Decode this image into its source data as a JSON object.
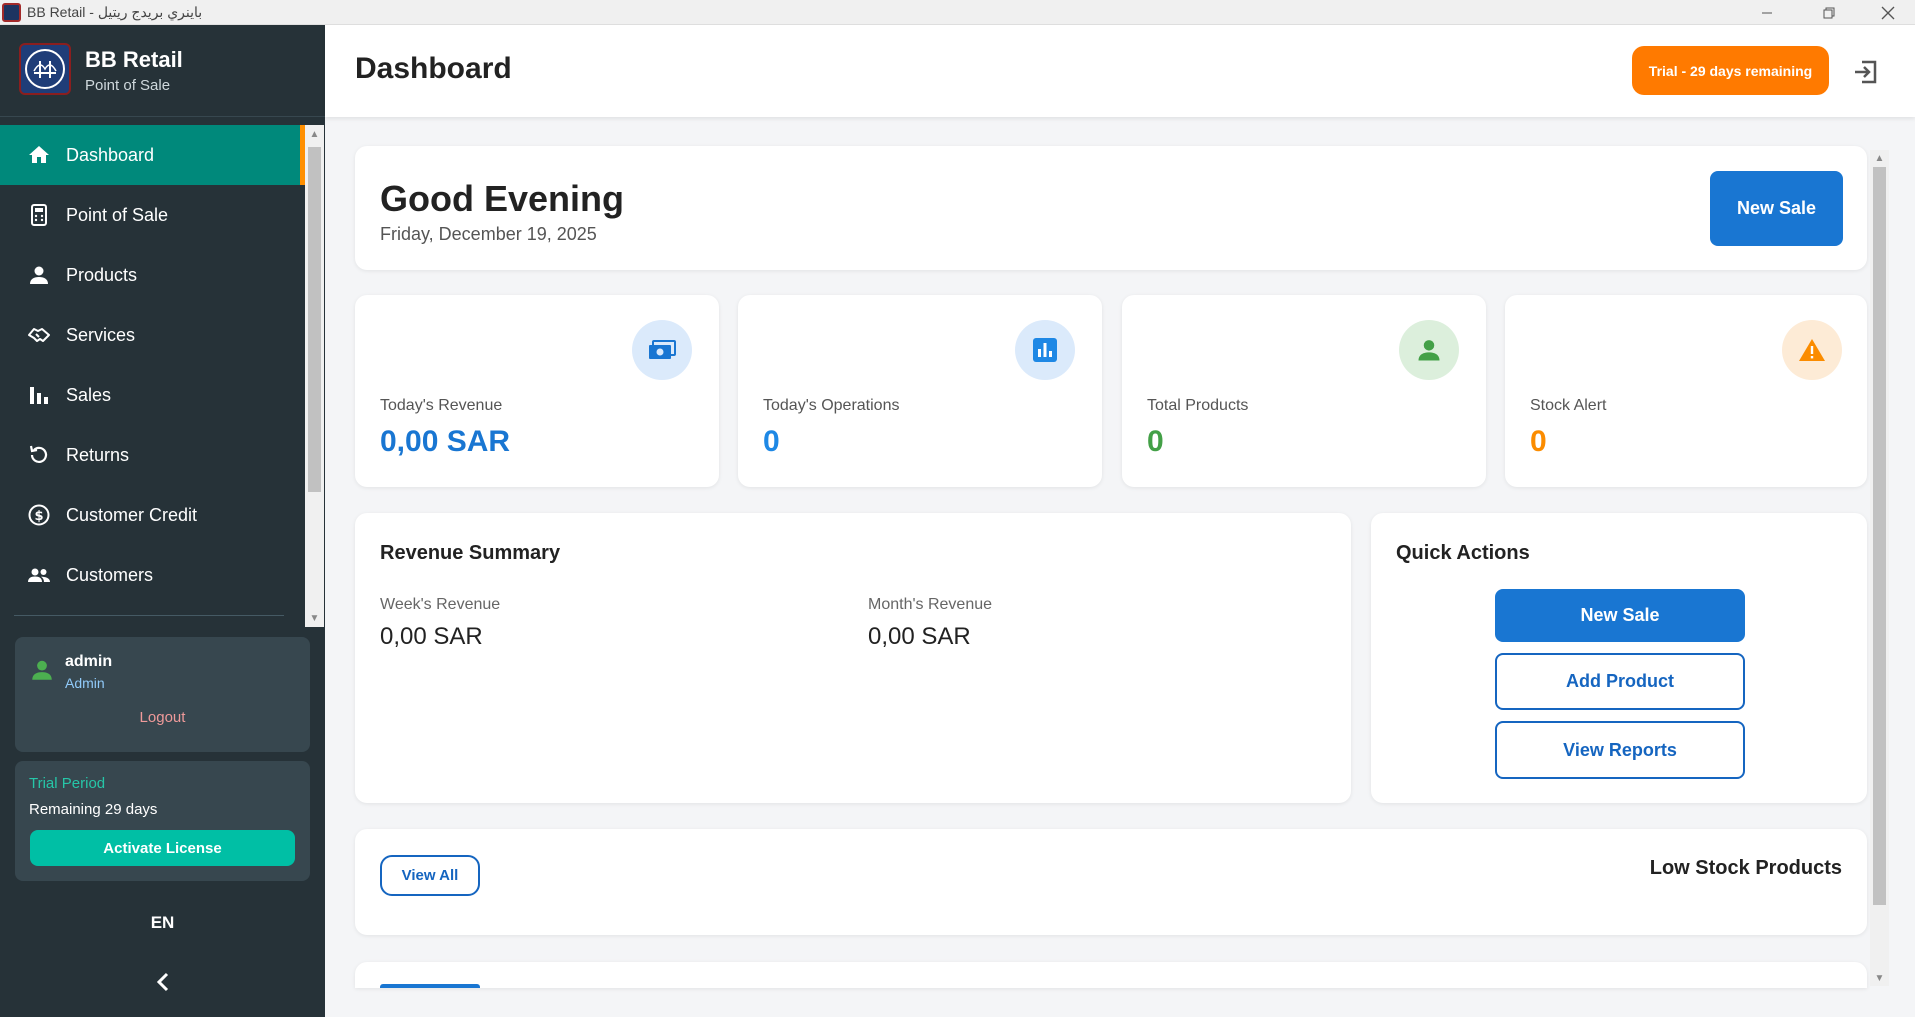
{
  "window": {
    "title": "BB Retail - باينري بريدج ريتيل"
  },
  "brand": {
    "name": "BB Retail",
    "subtitle": "Point of Sale"
  },
  "sidebar": {
    "items": [
      {
        "label": "Dashboard",
        "icon": "home-icon",
        "active": true
      },
      {
        "label": "Point of Sale",
        "icon": "calculator-icon"
      },
      {
        "label": "Products",
        "icon": "person-icon"
      },
      {
        "label": "Services",
        "icon": "handshake-icon"
      },
      {
        "label": "Sales",
        "icon": "bar-chart-icon"
      },
      {
        "label": "Returns",
        "icon": "undo-icon"
      },
      {
        "label": "Customer Credit",
        "icon": "dollar-circle-icon"
      },
      {
        "label": "Customers",
        "icon": "people-icon"
      }
    ],
    "user": {
      "name": "admin",
      "role": "Admin",
      "logout_label": "Logout"
    },
    "trial": {
      "title": "Trial Period",
      "remaining": "Remaining 29 days",
      "activate_label": "Activate License"
    },
    "language": "EN"
  },
  "header": {
    "title": "Dashboard",
    "trial_badge": "Trial - 29 days remaining"
  },
  "welcome": {
    "greeting": "Good Evening",
    "date": "Friday, December 19, 2025",
    "new_sale_label": "New Sale"
  },
  "stats": [
    {
      "label": "Today's Revenue",
      "value": "0,00 SAR",
      "color": "#1976d2",
      "icon": "money-icon"
    },
    {
      "label": "Today's Operations",
      "value": "0",
      "color": "#1e88e5",
      "icon": "bar-chart-icon"
    },
    {
      "label": "Total Products",
      "value": "0",
      "color": "#43a047",
      "icon": "person-icon"
    },
    {
      "label": "Stock Alert",
      "value": "0",
      "color": "#fb8c00",
      "icon": "warning-icon"
    }
  ],
  "revenue_summary": {
    "title": "Revenue Summary",
    "week_label": "Week's Revenue",
    "week_value": "0,00 SAR",
    "month_label": "Month's Revenue",
    "month_value": "0,00 SAR"
  },
  "quick_actions": {
    "title": "Quick Actions",
    "new_sale": "New Sale",
    "add_product": "Add Product",
    "view_reports": "View Reports"
  },
  "low_stock": {
    "title": "Low Stock Products",
    "view_all": "View All"
  }
}
